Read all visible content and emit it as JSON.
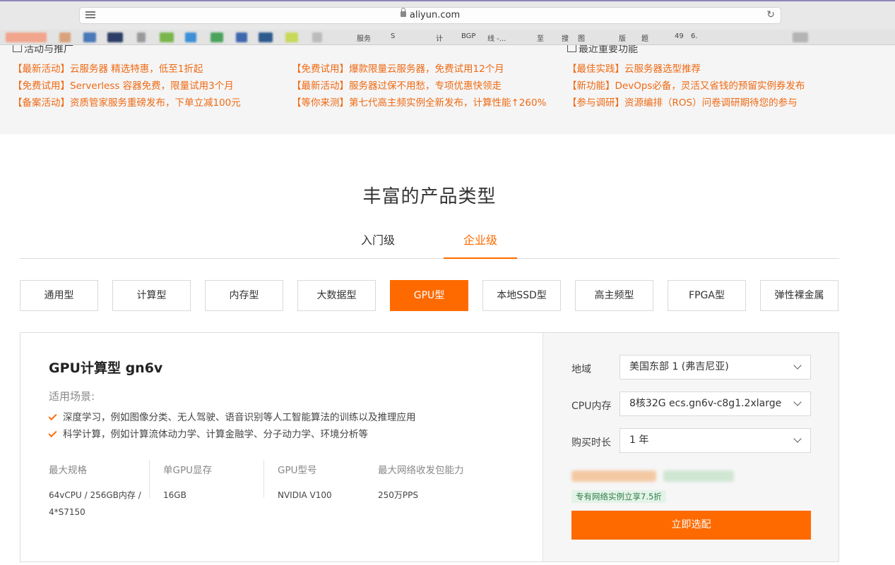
{
  "browser": {
    "url": "aliyun.com",
    "bookmark_texts": [
      "服务",
      "S",
      "计",
      "BGP",
      "线 -...",
      "至",
      "搜",
      "图",
      "版",
      "题",
      "49",
      "6."
    ]
  },
  "announcements": {
    "columns": [
      {
        "heading": "活动与推广",
        "items": [
          "【最新活动】云服务器 精选特惠，低至1折起",
          "【免费试用】Serverless 容器免费，限量试用3个月",
          "【备案活动】资质管家服务重磅发布，下单立减100元"
        ]
      },
      {
        "heading": "",
        "items": [
          "【免费试用】爆款限量云服务器，免费试用12个月",
          "【最新活动】服务器过保不用愁，专项优惠快领走",
          "【等你来测】第七代高主频实例全新发布，计算性能↑260%"
        ]
      },
      {
        "heading": "最近重要功能",
        "items": [
          "【最佳实践】云服务器选型推荐",
          "【新功能】DevOps必备，灵活又省钱的预留实例券发布",
          "【参与调研】资源编排（ROS）问卷调研期待您的参与"
        ]
      }
    ]
  },
  "section": {
    "title": "丰富的产品类型",
    "tabs": [
      {
        "label": "入门级",
        "active": false
      },
      {
        "label": "企业级",
        "active": true
      }
    ],
    "types": [
      {
        "label": "通用型",
        "active": false
      },
      {
        "label": "计算型",
        "active": false
      },
      {
        "label": "内存型",
        "active": false
      },
      {
        "label": "大数据型",
        "active": false
      },
      {
        "label": "GPU型",
        "active": true
      },
      {
        "label": "本地SSD型",
        "active": false
      },
      {
        "label": "高主频型",
        "active": false
      },
      {
        "label": "FPGA型",
        "active": false
      },
      {
        "label": "弹性裸金属",
        "active": false
      }
    ]
  },
  "product": {
    "title": "GPU计算型 gn6v",
    "scene_label": "适用场景:",
    "scenes": [
      "深度学习，例如图像分类、无人驾驶、语音识别等人工智能算法的训练以及推理应用",
      "科学计算，例如计算流体动力学、计算金融学、分子动力学、环境分析等"
    ],
    "specs": [
      {
        "label": "最大规格",
        "value_line1": "64vCPU / 256GB内存 /",
        "value_line2": "4*S7150"
      },
      {
        "label": "单GPU显存",
        "value_line1": "16GB",
        "value_line2": ""
      },
      {
        "label": "GPU型号",
        "value_line1": "NVIDIA V100",
        "value_line2": ""
      },
      {
        "label": "最大网络收发包能力",
        "value_line1": "250万PPS",
        "value_line2": ""
      }
    ]
  },
  "config": {
    "region_label": "地域",
    "region_value": "美国东部 1 (弗吉尼亚)",
    "cpu_label": "CPU内存",
    "cpu_value": "8核32G ecs.gn6v-c8g1.2xlarge",
    "duration_label": "购买时长",
    "duration_value": "1 年",
    "discount_badge": "专有网络实例立享7.5折",
    "buy_label": "立即选配"
  },
  "colors": {
    "accent": "#ff6a00",
    "news_text": "#ef6a12",
    "discount_bg": "#e4f3e8",
    "discount_text": "#2f7d4a"
  }
}
